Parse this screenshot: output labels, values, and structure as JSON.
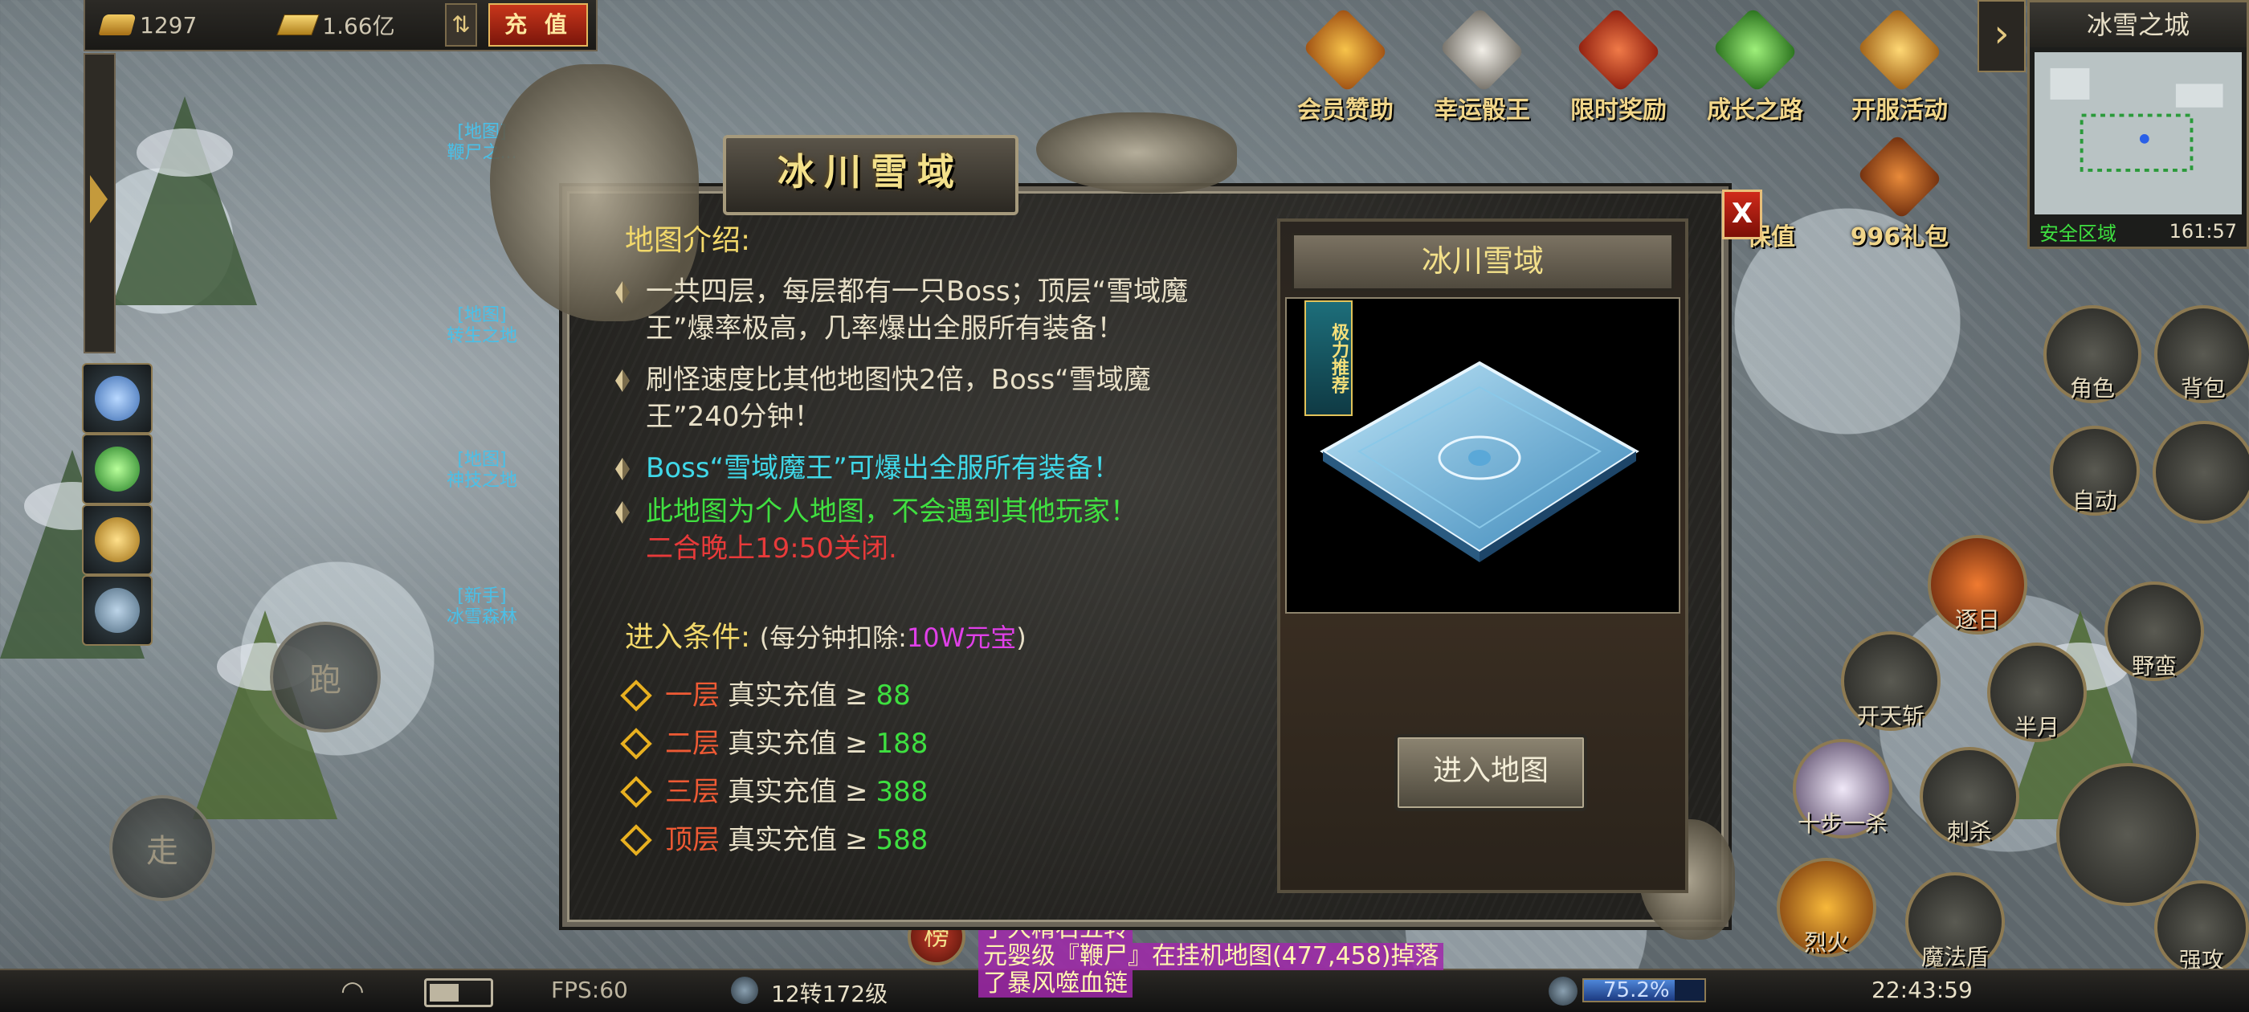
{
  "currency": {
    "gold_ingot": "1297",
    "gold_bar": "1.66亿",
    "recharge_label": "充 值",
    "swap_icon": "⇅"
  },
  "left_npcs": [
    {
      "tag": "[地图]",
      "name": "鞭尸之..."
    },
    {
      "tag": "[地图]",
      "name": "转生之地"
    },
    {
      "tag": "[地图]",
      "name": "神技之地"
    },
    {
      "tag": "[新手]",
      "name": "冰雪森林"
    }
  ],
  "joystick": {
    "run": "跑",
    "walk": "走"
  },
  "top_icons": [
    {
      "label": "会员赞助",
      "icon": "vip-chevron-icon",
      "color": "#e8821e"
    },
    {
      "label": "幸运骰王",
      "icon": "dice-icon",
      "color": "#d8d4cc"
    },
    {
      "label": "限时奖励",
      "icon": "gift-box-icon",
      "color": "#c8321e"
    },
    {
      "label": "成长之路",
      "icon": "green-arrow-icon",
      "color": "#3ca83a"
    },
    {
      "label": "开服活动",
      "icon": "throne-icon",
      "color": "#e4a82a"
    }
  ],
  "minimap": {
    "title": "冰雪之城",
    "zone": "安全区域",
    "coords": "161:57",
    "expand_icon": "›"
  },
  "right_icons": [
    {
      "label": "保值"
    },
    {
      "label": "996礼包"
    }
  ],
  "side_buttons": [
    {
      "label": "角色",
      "icon": "helmet-icon"
    },
    {
      "label": "背包",
      "icon": "bag-icon"
    },
    {
      "label": "自动",
      "icon": "crossed-swords-icon"
    }
  ],
  "skills": [
    {
      "label": "逐日"
    },
    {
      "label": "野蛮"
    },
    {
      "label": "开天斩"
    },
    {
      "label": "半月"
    },
    {
      "label": "十步一杀"
    },
    {
      "label": "刺杀"
    },
    {
      "label": "烈火"
    },
    {
      "label": "魔法盾"
    },
    {
      "label": "强攻"
    }
  ],
  "dialog": {
    "title": "冰川雪域",
    "close_label": "X",
    "intro_heading": "地图介绍:",
    "bullets": [
      {
        "text": "一共四层，每层都有一只Boss；顶层“雪域魔王”爆率极高，几率爆出全服所有装备！",
        "color": "#e8e0c8"
      },
      {
        "text": "刷怪速度比其他地图快2倍，Boss“雪域魔王”240分钟！",
        "color": "#e8e0c8"
      },
      {
        "text": "Boss“雪域魔王”可爆出全服所有装备！",
        "color": "#40d8e8"
      },
      {
        "text": "此地图为个人地图，不会遇到其他玩家！",
        "color": "#40e040",
        "extra": "二合晚上19:50关闭.",
        "extra_color": "#e83a3a"
      }
    ],
    "conditions_heading": "进入条件:",
    "conditions_note_prefix": "(每分钟扣除:",
    "conditions_note_value": "10W元宝",
    "conditions_note_suffix": ")",
    "conditions": [
      {
        "level": "一层",
        "label": "真实充值",
        "op": "≥",
        "value": "88"
      },
      {
        "level": "二层",
        "label": "真实充值",
        "op": "≥",
        "value": "188"
      },
      {
        "level": "三层",
        "label": "真实充值",
        "op": "≥",
        "value": "388"
      },
      {
        "level": "顶层",
        "label": "真实充值",
        "op": "≥",
        "value": "588"
      }
    ],
    "panel_title": "冰川雪域",
    "recommend_badge": "极力推荐",
    "enter_button": "进入地图"
  },
  "chat": [
    "了大精石五转",
    "元婴级『鞭尸』在挂机地图(477,458)掉落",
    "了暴风噬血链"
  ],
  "status": {
    "fps": "FPS:60",
    "level": "12转172级",
    "exp_percent": "75.2%",
    "exp_fraction": 0.752,
    "time": "22:43:59",
    "rank_label": "榜"
  }
}
